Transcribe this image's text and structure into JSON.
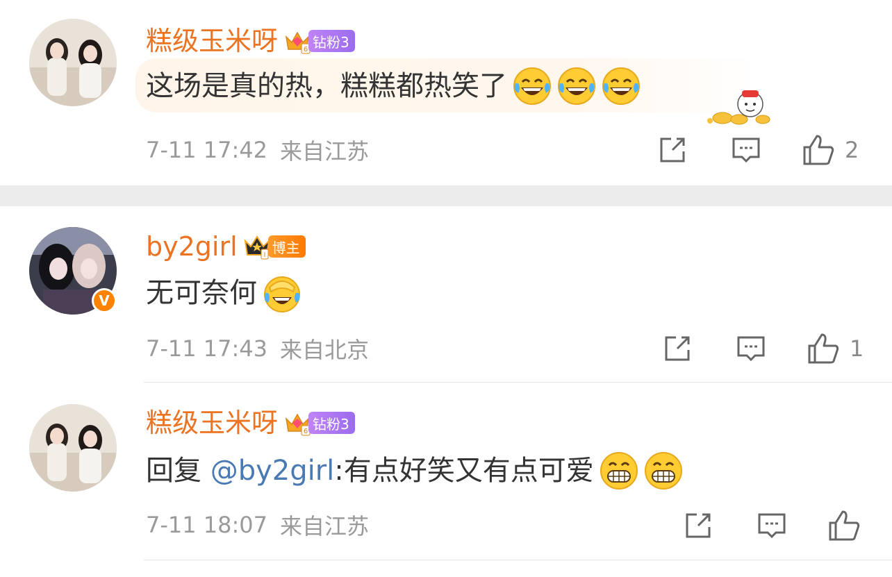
{
  "comments": [
    {
      "username": "糕级玉米呀",
      "badge_label": "钻粉3",
      "text": "这场是真的热，糕糕都热笑了",
      "emojis": [
        "laugh-cry-emoji",
        "laugh-cry-emoji",
        "laugh-cry-emoji"
      ],
      "time": "7-11 17:42",
      "location": "来自江苏",
      "likes": "2"
    },
    {
      "username": "by2girl",
      "badge_label": "博主",
      "verified": "V",
      "text": "无可奈何",
      "emojis": [
        "facepalm-laugh-emoji"
      ],
      "time": "7-11 17:43",
      "location": "来自北京",
      "likes": "1"
    },
    {
      "username": "糕级玉米呀",
      "badge_label": "钻粉3",
      "reply_prefix": "回复 ",
      "reply_mention": "@by2girl",
      "text": ":有点好笑又有点可爱",
      "emojis": [
        "grin-emoji",
        "grin-emoji"
      ],
      "time": "7-11 18:07",
      "location": "来自江苏",
      "likes": ""
    }
  ],
  "colors": {
    "username": "#eb7321",
    "mention": "#4a7ab3",
    "meta": "#9a9a9a",
    "separator": "#ececec",
    "diamond_badge": "#b07af3",
    "blogger_badge": "#ff8200"
  }
}
